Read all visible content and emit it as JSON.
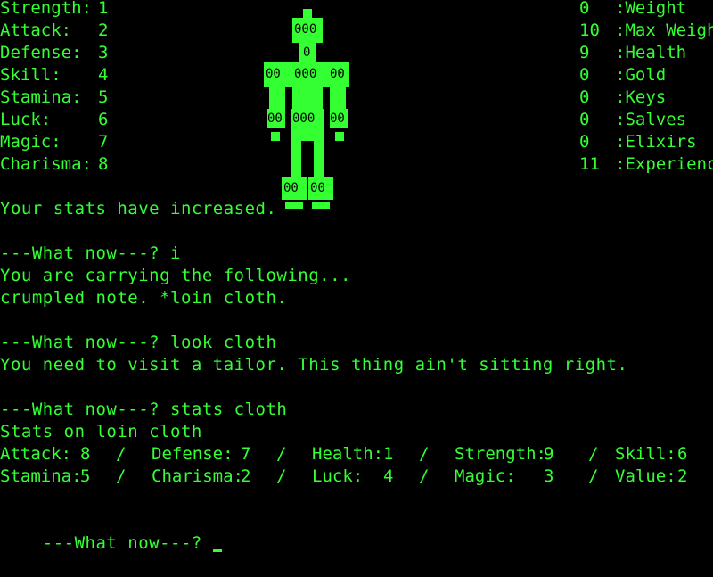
{
  "left_stats": [
    {
      "name": "Strength:",
      "value": "1"
    },
    {
      "name": "Attack:",
      "value": "2"
    },
    {
      "name": "Defense:",
      "value": "3"
    },
    {
      "name": "Skill:",
      "value": "4"
    },
    {
      "name": "Stamina:",
      "value": "5"
    },
    {
      "name": "Luck:",
      "value": "6"
    },
    {
      "name": "Magic:",
      "value": "7"
    },
    {
      "name": "Charisma:",
      "value": "8"
    }
  ],
  "right_stats": [
    {
      "value": "0",
      "name": ":Weight"
    },
    {
      "value": "10",
      "name": ":Max Weight"
    },
    {
      "value": "9",
      "name": ":Health"
    },
    {
      "value": "0",
      "name": ":Gold"
    },
    {
      "value": "0",
      "name": ":Keys"
    },
    {
      "value": "0",
      "name": ":Salves"
    },
    {
      "value": "0",
      "name": ":Elixirs"
    },
    {
      "value": "11",
      "name": ":Experience"
    }
  ],
  "log": {
    "stats_increased": "Your stats have increased.",
    "prompt1": "---What now---? i",
    "carrying_header": "You are carrying the following...",
    "carrying_items": "crumpled note. *loin cloth.",
    "prompt2": "---What now---? look cloth",
    "look_response": "You need to visit a tailor. This thing ain't sitting right.",
    "prompt3": "---What now---? stats cloth",
    "stats_on": "Stats on loin cloth",
    "prompt4": "---What now---? "
  },
  "item_stats_row1": [
    {
      "label": "Attack:",
      "value": "8"
    },
    {
      "label": "Defense:",
      "value": "7"
    },
    {
      "label": "Health:",
      "value": "1"
    },
    {
      "label": "Strength:",
      "value": "9"
    },
    {
      "label": "Skill:",
      "value": "6"
    }
  ],
  "item_stats_row2": [
    {
      "label": "Stamina:",
      "value": "5"
    },
    {
      "label": "Charisma:",
      "value": "2"
    },
    {
      "label": "Luck:",
      "value": "4"
    },
    {
      "label": "Magic:",
      "value": "3"
    },
    {
      "label": "Value:",
      "value": "2"
    }
  ],
  "separator": "/",
  "figure_labels": {
    "head": "000",
    "neck": "0",
    "left_shoulder": "00",
    "chest": "000",
    "right_shoulder": "00",
    "left_hand": "00",
    "waist": "000",
    "right_hand": "00",
    "left_foot": "00",
    "right_foot": "00"
  },
  "colors": {
    "foreground": "#33ff33",
    "background": "#000000"
  }
}
